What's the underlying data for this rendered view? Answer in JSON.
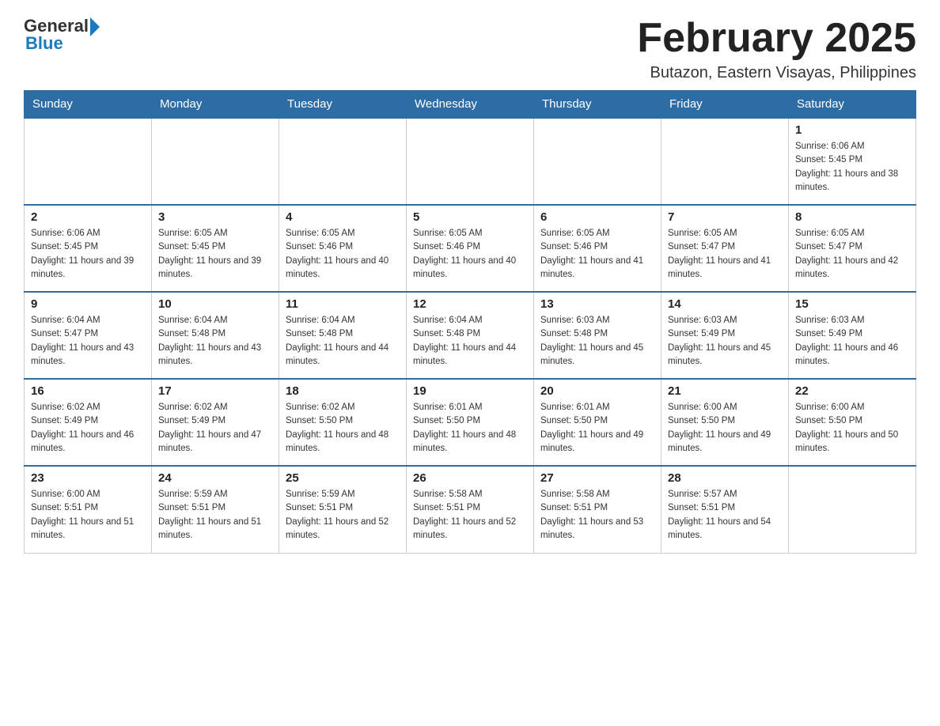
{
  "header": {
    "logo_general": "General",
    "logo_blue": "Blue",
    "month_title": "February 2025",
    "location": "Butazon, Eastern Visayas, Philippines"
  },
  "weekdays": [
    "Sunday",
    "Monday",
    "Tuesday",
    "Wednesday",
    "Thursday",
    "Friday",
    "Saturday"
  ],
  "weeks": [
    [
      null,
      null,
      null,
      null,
      null,
      null,
      {
        "day": "1",
        "sunrise": "Sunrise: 6:06 AM",
        "sunset": "Sunset: 5:45 PM",
        "daylight": "Daylight: 11 hours and 38 minutes."
      }
    ],
    [
      {
        "day": "2",
        "sunrise": "Sunrise: 6:06 AM",
        "sunset": "Sunset: 5:45 PM",
        "daylight": "Daylight: 11 hours and 39 minutes."
      },
      {
        "day": "3",
        "sunrise": "Sunrise: 6:05 AM",
        "sunset": "Sunset: 5:45 PM",
        "daylight": "Daylight: 11 hours and 39 minutes."
      },
      {
        "day": "4",
        "sunrise": "Sunrise: 6:05 AM",
        "sunset": "Sunset: 5:46 PM",
        "daylight": "Daylight: 11 hours and 40 minutes."
      },
      {
        "day": "5",
        "sunrise": "Sunrise: 6:05 AM",
        "sunset": "Sunset: 5:46 PM",
        "daylight": "Daylight: 11 hours and 40 minutes."
      },
      {
        "day": "6",
        "sunrise": "Sunrise: 6:05 AM",
        "sunset": "Sunset: 5:46 PM",
        "daylight": "Daylight: 11 hours and 41 minutes."
      },
      {
        "day": "7",
        "sunrise": "Sunrise: 6:05 AM",
        "sunset": "Sunset: 5:47 PM",
        "daylight": "Daylight: 11 hours and 41 minutes."
      },
      {
        "day": "8",
        "sunrise": "Sunrise: 6:05 AM",
        "sunset": "Sunset: 5:47 PM",
        "daylight": "Daylight: 11 hours and 42 minutes."
      }
    ],
    [
      {
        "day": "9",
        "sunrise": "Sunrise: 6:04 AM",
        "sunset": "Sunset: 5:47 PM",
        "daylight": "Daylight: 11 hours and 43 minutes."
      },
      {
        "day": "10",
        "sunrise": "Sunrise: 6:04 AM",
        "sunset": "Sunset: 5:48 PM",
        "daylight": "Daylight: 11 hours and 43 minutes."
      },
      {
        "day": "11",
        "sunrise": "Sunrise: 6:04 AM",
        "sunset": "Sunset: 5:48 PM",
        "daylight": "Daylight: 11 hours and 44 minutes."
      },
      {
        "day": "12",
        "sunrise": "Sunrise: 6:04 AM",
        "sunset": "Sunset: 5:48 PM",
        "daylight": "Daylight: 11 hours and 44 minutes."
      },
      {
        "day": "13",
        "sunrise": "Sunrise: 6:03 AM",
        "sunset": "Sunset: 5:48 PM",
        "daylight": "Daylight: 11 hours and 45 minutes."
      },
      {
        "day": "14",
        "sunrise": "Sunrise: 6:03 AM",
        "sunset": "Sunset: 5:49 PM",
        "daylight": "Daylight: 11 hours and 45 minutes."
      },
      {
        "day": "15",
        "sunrise": "Sunrise: 6:03 AM",
        "sunset": "Sunset: 5:49 PM",
        "daylight": "Daylight: 11 hours and 46 minutes."
      }
    ],
    [
      {
        "day": "16",
        "sunrise": "Sunrise: 6:02 AM",
        "sunset": "Sunset: 5:49 PM",
        "daylight": "Daylight: 11 hours and 46 minutes."
      },
      {
        "day": "17",
        "sunrise": "Sunrise: 6:02 AM",
        "sunset": "Sunset: 5:49 PM",
        "daylight": "Daylight: 11 hours and 47 minutes."
      },
      {
        "day": "18",
        "sunrise": "Sunrise: 6:02 AM",
        "sunset": "Sunset: 5:50 PM",
        "daylight": "Daylight: 11 hours and 48 minutes."
      },
      {
        "day": "19",
        "sunrise": "Sunrise: 6:01 AM",
        "sunset": "Sunset: 5:50 PM",
        "daylight": "Daylight: 11 hours and 48 minutes."
      },
      {
        "day": "20",
        "sunrise": "Sunrise: 6:01 AM",
        "sunset": "Sunset: 5:50 PM",
        "daylight": "Daylight: 11 hours and 49 minutes."
      },
      {
        "day": "21",
        "sunrise": "Sunrise: 6:00 AM",
        "sunset": "Sunset: 5:50 PM",
        "daylight": "Daylight: 11 hours and 49 minutes."
      },
      {
        "day": "22",
        "sunrise": "Sunrise: 6:00 AM",
        "sunset": "Sunset: 5:50 PM",
        "daylight": "Daylight: 11 hours and 50 minutes."
      }
    ],
    [
      {
        "day": "23",
        "sunrise": "Sunrise: 6:00 AM",
        "sunset": "Sunset: 5:51 PM",
        "daylight": "Daylight: 11 hours and 51 minutes."
      },
      {
        "day": "24",
        "sunrise": "Sunrise: 5:59 AM",
        "sunset": "Sunset: 5:51 PM",
        "daylight": "Daylight: 11 hours and 51 minutes."
      },
      {
        "day": "25",
        "sunrise": "Sunrise: 5:59 AM",
        "sunset": "Sunset: 5:51 PM",
        "daylight": "Daylight: 11 hours and 52 minutes."
      },
      {
        "day": "26",
        "sunrise": "Sunrise: 5:58 AM",
        "sunset": "Sunset: 5:51 PM",
        "daylight": "Daylight: 11 hours and 52 minutes."
      },
      {
        "day": "27",
        "sunrise": "Sunrise: 5:58 AM",
        "sunset": "Sunset: 5:51 PM",
        "daylight": "Daylight: 11 hours and 53 minutes."
      },
      {
        "day": "28",
        "sunrise": "Sunrise: 5:57 AM",
        "sunset": "Sunset: 5:51 PM",
        "daylight": "Daylight: 11 hours and 54 minutes."
      },
      null
    ]
  ]
}
